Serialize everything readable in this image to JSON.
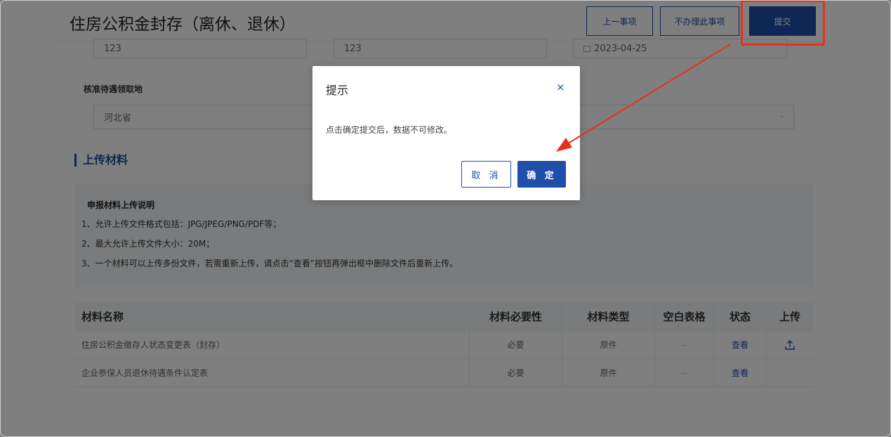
{
  "header": {
    "title": "住房公积金封存（离休、退休）",
    "prev_label": "上一事项",
    "skip_label": "不办理此事项",
    "submit_label": "提交"
  },
  "form": {
    "field1_value": "123",
    "field2_value": "123",
    "date_value": "2023-04-25",
    "pickup_label": "核准待遇领取地",
    "pickup_value": "河北省"
  },
  "upload": {
    "section_title": "上传材料",
    "notice_title": "申报材料上传说明",
    "lines": [
      "1、允许上传文件格式包括：JPG/JPEG/PNG/PDF等；",
      "2、最大允许上传文件大小：20M；",
      "3、一个材料可以上传多份文件，若需重新上传，请点击“查看”按钮再弹出框中删除文件后重新上传。"
    ]
  },
  "table": {
    "headers": [
      "材料名称",
      "材料必要性",
      "材料类型",
      "空白表格",
      "状态",
      "上传"
    ],
    "rows": [
      {
        "name": "住房公积金缴存人状态变更表（封存）",
        "necessity": "必要",
        "type": "原件",
        "blank": "--",
        "status": "查看"
      },
      {
        "name": "企业参保人员退休待遇条件认定表",
        "necessity": "必要",
        "type": "原件",
        "blank": "--",
        "status": "查看"
      }
    ]
  },
  "dialog": {
    "title": "提示",
    "close_icon": "×",
    "message": "点击确定提交后，数据不可修改。",
    "cancel_label": "取 消",
    "ok_label": "确 定"
  },
  "colors": {
    "primary": "#1f4fa8",
    "annotation_red": "#e8301e"
  }
}
